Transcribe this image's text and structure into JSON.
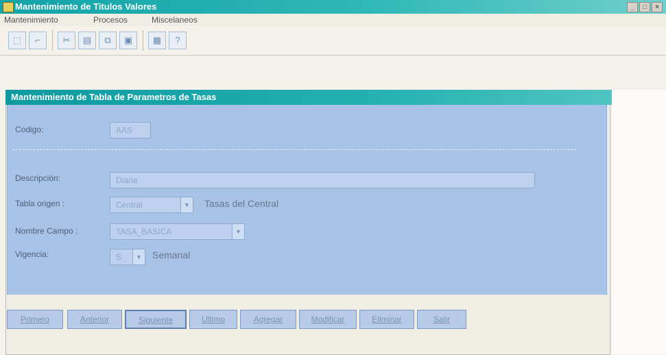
{
  "window": {
    "title": "Mantenimiento de Titulos Valores",
    "controls": [
      "_",
      "□",
      "×"
    ]
  },
  "menu": [
    "Mantenimiento",
    "Procesos",
    "Miscelaneos"
  ],
  "toolbar": {
    "icons": [
      "open-icon",
      "close-icon",
      "cut-icon",
      "paste-icon",
      "copy-icon",
      "save-icon",
      "calculator-icon",
      "help-icon"
    ]
  },
  "panel": {
    "title": "Mantenimiento de Tabla de Parametros de Tasas"
  },
  "form": {
    "codigo_label": "Codigo:",
    "codigo_value": "AAS",
    "descripcion_label": "Descripción:",
    "descripcion_value": "Diaria",
    "tabla_origen_label": "Tabla origen :",
    "tabla_origen_value": "Central",
    "tabla_origen_desc": "Tasas del Central",
    "nombre_campo_label": "Nombre Campo :",
    "nombre_campo_value": "TASA_BASICA",
    "vigencia_label": "Vigencia:",
    "vigencia_value": "S",
    "vigencia_desc": "Semanal"
  },
  "buttons": {
    "primero": "Primero",
    "anterior": "Anterior",
    "siguiente": "Siguiente",
    "ultimo": "Ultimo",
    "agregar": "Agregar",
    "modificar": "Modificar",
    "eliminar": "Eliminar",
    "salir": "Salir"
  }
}
